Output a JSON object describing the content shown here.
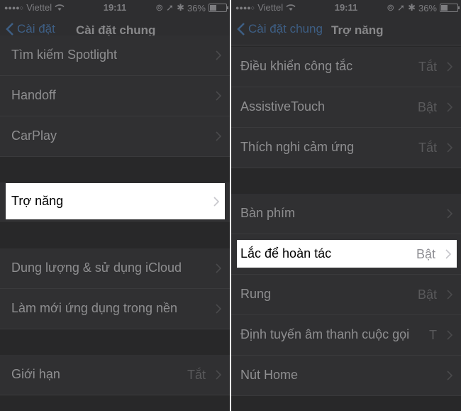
{
  "status": {
    "carrier": "Viettel",
    "time": "19:11",
    "battery": "36%"
  },
  "left": {
    "nav": {
      "back_label": "Cài đặt",
      "title": "Cài đặt chung"
    },
    "rows": [
      {
        "label": "Tìm kiếm Spotlight"
      },
      {
        "label": "Handoff"
      },
      {
        "label": "CarPlay"
      },
      {
        "label": "Trợ năng"
      },
      {
        "label": "Dung lượng & sử dụng iCloud"
      },
      {
        "label": "Làm mới ứng dụng trong nền"
      },
      {
        "label": "Giới hạn",
        "value": "Tắt"
      }
    ]
  },
  "right": {
    "nav": {
      "back_label": "Cài đặt chung",
      "title": "Trợ năng"
    },
    "rows": [
      {
        "label": "Điều khiển công tắc",
        "value": "Tắt"
      },
      {
        "label": "AssistiveTouch",
        "value": "Bật"
      },
      {
        "label": "Thích nghi cảm ứng",
        "value": "Tắt"
      },
      {
        "label": "Bàn phím"
      },
      {
        "label": "Lắc để hoàn tác",
        "value": "Bật"
      },
      {
        "label": "Rung",
        "value": "Bật"
      },
      {
        "label": "Định tuyến âm thanh cuộc gọi",
        "value": "T"
      },
      {
        "label": "Nút Home"
      }
    ]
  },
  "colors": {
    "dim_background": "#2e2e30",
    "highlight": "#ffffff",
    "back_link": "#3e5f85"
  }
}
